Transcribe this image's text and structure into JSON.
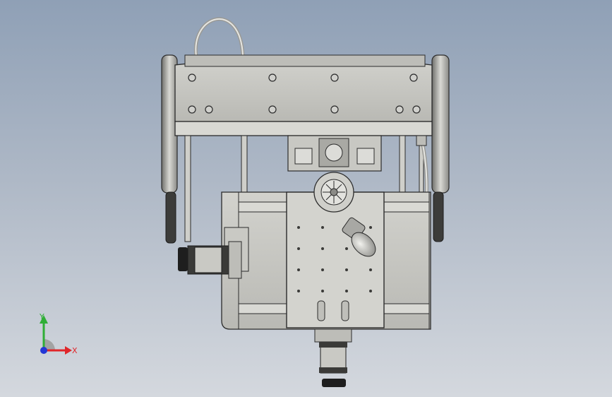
{
  "viewport": {
    "background_top": "#8fa0b6",
    "background_bottom": "#d4d8de"
  },
  "model": {
    "body_color": "#c4c4c0",
    "edge_color": "#2b2b2b",
    "plate_color": "#cfcfca",
    "dark_color": "#1e1e1e"
  },
  "triad": {
    "x_label": "X",
    "y_label": "Y",
    "x_color": "#e0262a",
    "y_color": "#2fae36",
    "z_color": "#2437d6"
  }
}
